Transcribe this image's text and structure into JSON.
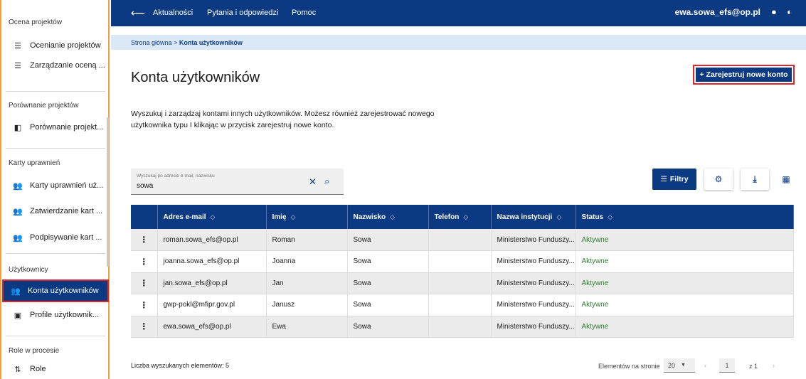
{
  "colors": {
    "primary": "#0b3a83",
    "highlight": "#e0262b",
    "sidebar_border": "#f0a040",
    "status_active": "#2e7d32",
    "breadcrumb_bg": "#dbe8f7"
  },
  "sidebar": {
    "groups": [
      {
        "heading": "Ocena projektów",
        "items": [
          {
            "label": "Ocenianie projektów",
            "icon": "list-icon"
          },
          {
            "label": "Zarządzanie oceną ...",
            "icon": "list-icon"
          }
        ]
      },
      {
        "heading": "Porównanie projektów",
        "items": [
          {
            "label": "Porównanie projekt...",
            "icon": "compare-icon"
          }
        ]
      },
      {
        "heading": "Karty uprawnień",
        "items": [
          {
            "label": "Karty uprawnień uż...",
            "icon": "users-icon"
          },
          {
            "label": "Zatwierdzanie kart ...",
            "icon": "users-icon"
          },
          {
            "label": "Podpisywanie kart ...",
            "icon": "users-icon"
          }
        ]
      },
      {
        "heading": "Użytkownicy",
        "items": [
          {
            "label": "Konta użytkowników",
            "icon": "users-icon"
          },
          {
            "label": "Profile użytkownik...",
            "icon": "profile-icon"
          }
        ]
      },
      {
        "heading": "Role w procesie",
        "items": [
          {
            "label": "Role",
            "icon": "sort-icon"
          }
        ]
      }
    ]
  },
  "topbar": {
    "nav": [
      "Aktualności",
      "Pytania i odpowiedzi",
      "Pomoc"
    ],
    "user": "ewa.sowa_efs@op.pl"
  },
  "breadcrumb": {
    "home": "Strona główna",
    "sep": ">",
    "current": "Konta użytkowników"
  },
  "page": {
    "title": "Konta użytkowników",
    "description_line1": "Wyszukuj i zarządzaj kontami innych użytkowników. Możesz również zarejestrować nowego",
    "description_line2": "użytkownika typu I klikając w przycisk zarejestruj nowe konto.",
    "register_button": "+ Zarejestruj nowe konto"
  },
  "search": {
    "placeholder": "Wyszukaj po adresie e-mail, nazwisku",
    "value": "sowa"
  },
  "toolbar": {
    "filters": "Filtry"
  },
  "table": {
    "columns": [
      "",
      "Adres e-mail",
      "Imię",
      "Nazwisko",
      "Telefon",
      "Nazwa instytucji",
      "Status"
    ],
    "rows": [
      [
        "roman.sowa_efs@op.pl",
        "Roman",
        "Sowa",
        "",
        "Ministerstwo Funduszy...",
        "Aktywne"
      ],
      [
        "joanna.sowa_efs@op.pl",
        "Joanna",
        "Sowa",
        "",
        "Ministerstwo Funduszy...",
        "Aktywne"
      ],
      [
        "jan.sowa_efs@op.pl",
        "Jan",
        "Sowa",
        "",
        "Ministerstwo Funduszy...",
        "Aktywne"
      ],
      [
        "gwp-pokl@mfipr.gov.pl",
        "Janusz",
        "Sowa",
        "",
        "Ministerstwo Funduszy...",
        "Aktywne"
      ],
      [
        "ewa.sowa_efs@op.pl",
        "Ewa",
        "Sowa",
        "",
        "Ministerstwo Funduszy...",
        "Aktywne"
      ]
    ]
  },
  "footer": {
    "count": "Liczba wyszukanych elementów: 5",
    "per_page_label": "Elementów na stronie",
    "per_page": "20",
    "page": "1",
    "of": "z 1"
  }
}
